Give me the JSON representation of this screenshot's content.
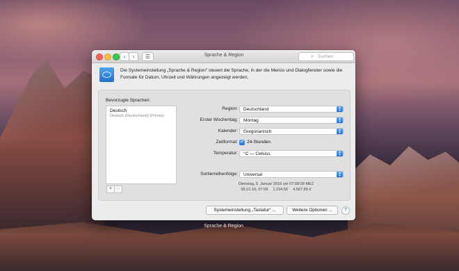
{
  "window": {
    "title": "Sprache & Region",
    "search_placeholder": "Suchen",
    "nav_back": "‹",
    "nav_forward": "›",
    "nav_grid": "☰"
  },
  "intro_text": "Die Systemeinstellung „Sprache & Region“ steuert die Sprache, in der die Menüs und Dialogfenster sowie die Formate für Datum, Uhrzeit und Währungen angezeigt werden.",
  "preferred": {
    "title": "Bevorzugte Sprachen:",
    "languages": [
      {
        "name": "Deutsch",
        "sub": "Deutsch (Deutschland) (Primär)"
      }
    ],
    "add": "+",
    "remove": "–"
  },
  "settings": {
    "region_label": "Region:",
    "region_value": "Deutschland",
    "weekday_label": "Erster Wochentag:",
    "weekday_value": "Montag",
    "calendar_label": "Kalender:",
    "calendar_value": "Gregorianisch",
    "timeformat_label": "Zeitformat:",
    "timeformat_value": "24-Stunden",
    "temperature_label": "Temperatur:",
    "temperature_value": "°C — Celsius",
    "sort_label": "Sortierreihenfolge:",
    "sort_value": "Universal"
  },
  "preview": {
    "line1": "Dienstag, 5. Januar 2016 um 07:08:09 MEZ",
    "date": "05.01.16, 07:08",
    "number": "1.234,56",
    "currency": "4.567,89 €"
  },
  "buttons": {
    "keyboard": "Systemeinstellung „Tastatur“ ...",
    "options": "Weitere Optionen ...",
    "help": "?"
  },
  "dock_label": "Sprache & Region",
  "colors": {
    "accent": "#1b6fe0"
  }
}
